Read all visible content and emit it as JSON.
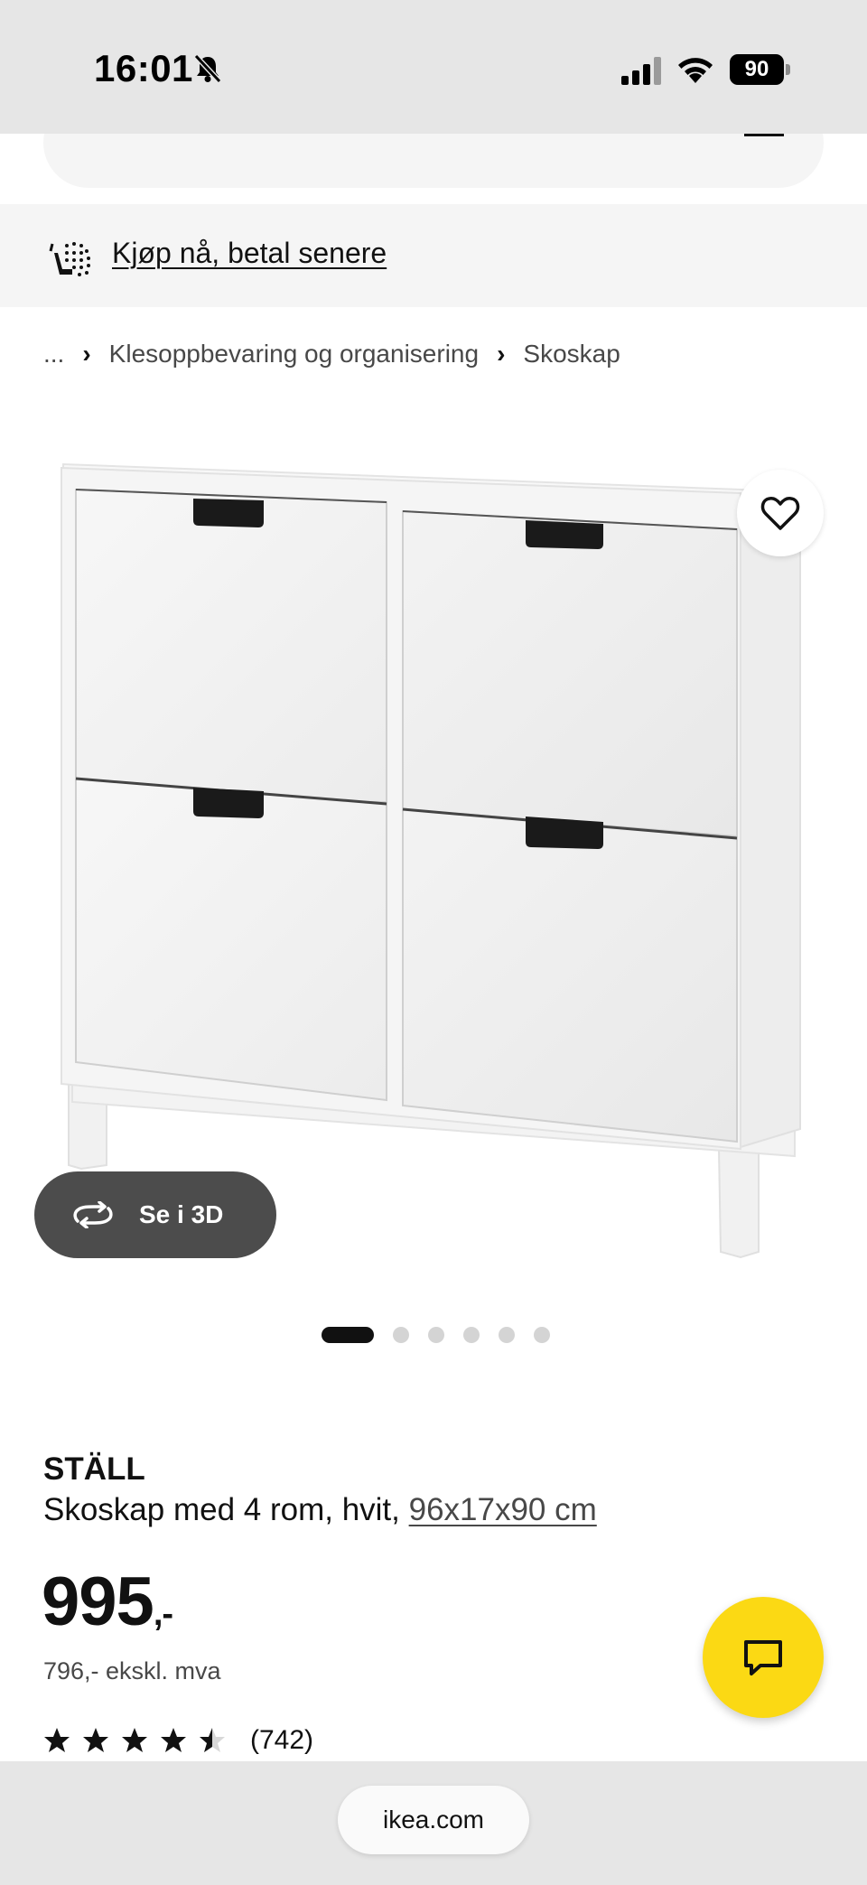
{
  "status_bar": {
    "time": "16:01",
    "battery": "90"
  },
  "banner": {
    "pay_later_label": "Kjøp nå, betal senere"
  },
  "breadcrumb": {
    "ellipsis": "...",
    "items": [
      "Klesoppbevaring og organisering",
      "Skoskap"
    ],
    "separator": "›"
  },
  "gallery": {
    "view_3d_label": "Se i 3D",
    "total_images": 6,
    "active_index": 0
  },
  "product": {
    "name": "STÄLL",
    "description": "Skoskap med 4 rom, hvit, ",
    "dimensions": "96x17x90 cm",
    "price": "995",
    "price_suffix": ",-",
    "price_excl_vat": "796,- ekskl. mva",
    "rating": 4.5,
    "rating_max": 5,
    "review_count": "(742)"
  },
  "browser": {
    "url": "ikea.com"
  },
  "colors": {
    "chat_button": "#fbd914",
    "view_3d_button": "#4c4c4c"
  },
  "icons": [
    "bell-slash-icon",
    "signal-icon",
    "wifi-icon",
    "battery-icon",
    "cart-pay-icon",
    "heart-icon",
    "rotate-3d-icon",
    "star-icon",
    "chat-icon"
  ]
}
